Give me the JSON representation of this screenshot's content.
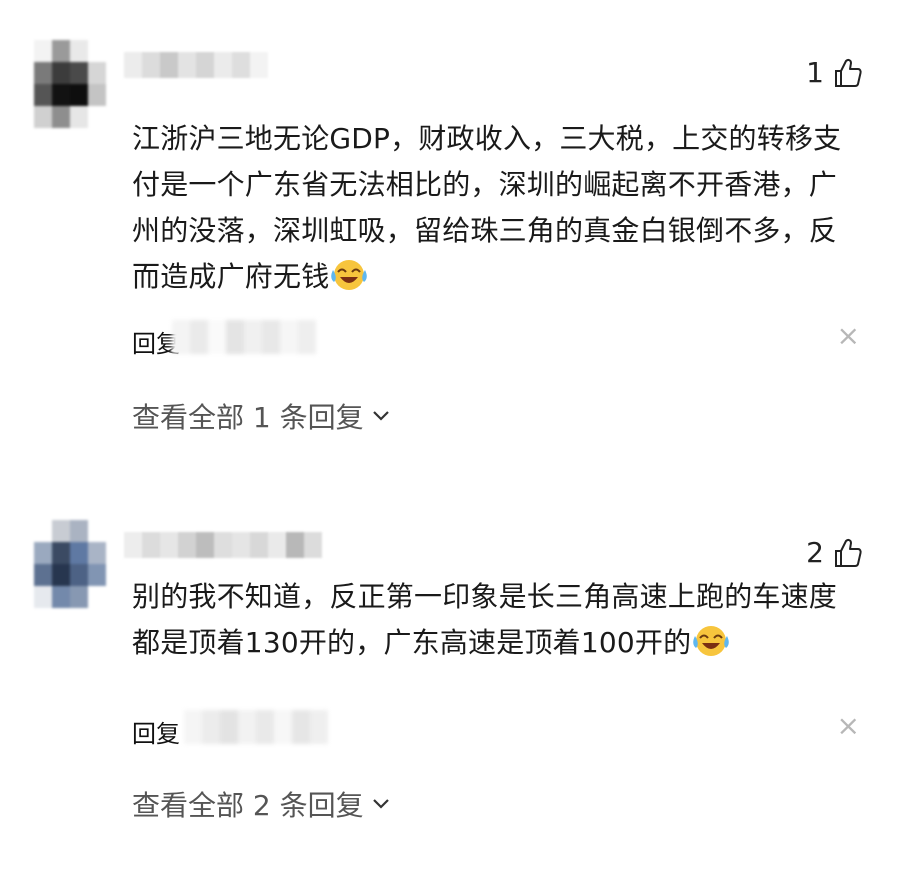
{
  "comments": [
    {
      "likes": "1",
      "text": "江浙沪三地无论GDP，财政收入，三大税，上交的转移支付是一个广东省无法相比的，深圳的崛起离不开香港，广州的没落，深圳虹吸，留给珠三角的真金白银倒不多，反而造成广府无钱",
      "reply_label": "回复",
      "view_all": "查看全部 1 条回复",
      "close": "×",
      "icons": {
        "like": "thumbs-up-icon",
        "emoji": "laughing-crying-emoji-icon",
        "chevron": "chevron-down-icon",
        "close": "close-icon"
      }
    },
    {
      "likes": "2",
      "text": "别的我不知道，反正第一印象是长三角高速上跑的车速度都是顶着130开的，广东高速是顶着100开的",
      "reply_label": "回复",
      "view_all": "查看全部 2 条回复",
      "close": "×",
      "icons": {
        "like": "thumbs-up-icon",
        "emoji": "laughing-crying-emoji-icon",
        "chevron": "chevron-down-icon",
        "close": "close-icon"
      }
    }
  ],
  "colors": {
    "text": "#1a1a1a",
    "muted": "#555555",
    "close": "#b7b7b7",
    "background": "#ffffff"
  }
}
